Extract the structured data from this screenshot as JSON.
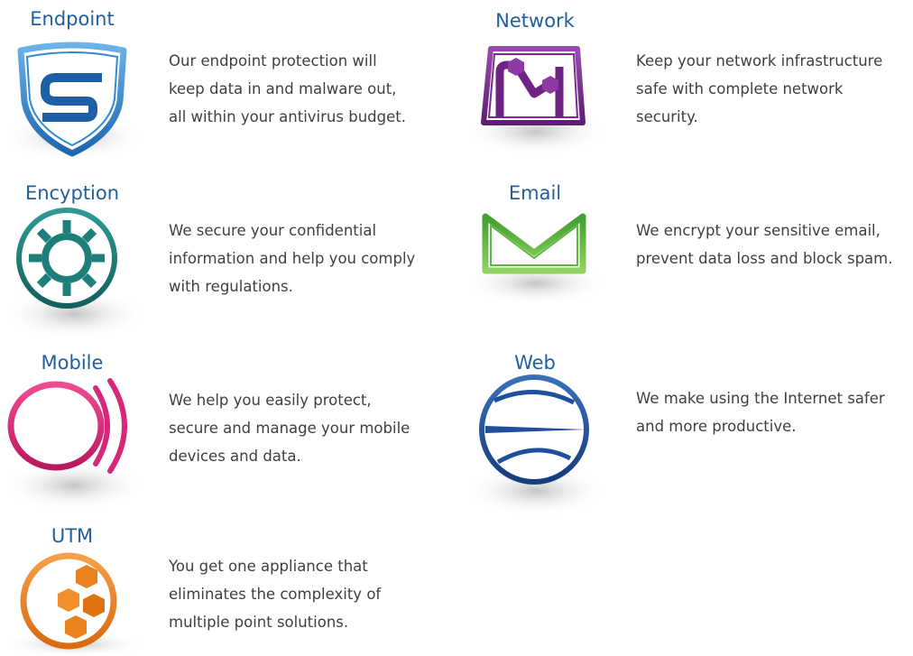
{
  "products": {
    "endpoint": {
      "title": "Endpoint",
      "line1": "Our endpoint protection will",
      "line2": "keep data in and malware out,",
      "line3": "all within your antivirus budget.",
      "icon": "shield-s-icon",
      "color": "#2a7fc4"
    },
    "network": {
      "title": "Network",
      "line1": "Keep your network infrastructure",
      "line2": "safe with complete network",
      "line3": "security.",
      "icon": "network-nodes-icon",
      "color": "#7b2a8e"
    },
    "encryption": {
      "title": "Encyption",
      "line1": "We secure your confidential",
      "line2": "information and help you comply",
      "line3": "with regulations.",
      "icon": "lock-dial-icon",
      "color": "#1e7f7a"
    },
    "email": {
      "title": "Email",
      "line1": "We encrypt your sensitive email,",
      "line2": "prevent data loss and block spam.",
      "icon": "envelope-icon",
      "color": "#5fb544"
    },
    "mobile": {
      "title": "Mobile",
      "line1": "We help you easily protect,",
      "line2": "secure and manage your mobile",
      "line3": "devices and data.",
      "icon": "mobile-signal-icon",
      "color": "#d8267a"
    },
    "web": {
      "title": "Web",
      "line1": "We make using the Internet safer",
      "line2": "and more productive.",
      "icon": "globe-icon",
      "color": "#1f4f9a"
    },
    "utm": {
      "title": "UTM",
      "line1": "You get one appliance that",
      "line2": "eliminates the complexity of",
      "line3": "multiple point solutions.",
      "icon": "hexagon-cluster-icon",
      "color": "#e9821e"
    }
  }
}
